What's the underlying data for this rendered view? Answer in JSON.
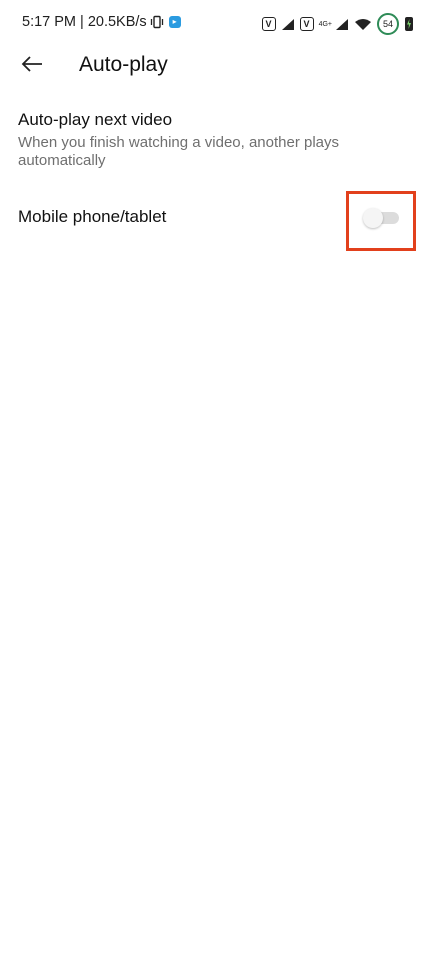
{
  "status_bar": {
    "time_speed": "5:17 PM | 20.5KB/s",
    "network_label": "4G+",
    "volte_1": "V",
    "volte_2": "V",
    "battery": "54"
  },
  "header": {
    "title": "Auto-play"
  },
  "autoplay_section": {
    "title": "Auto-play next video",
    "description": "When you finish watching a video, another plays automatically"
  },
  "settings": [
    {
      "label": "Mobile phone/tablet",
      "enabled": false
    }
  ],
  "colors": {
    "highlight": "#e2401c",
    "toggle_track": "#dcdcdc",
    "battery_ring": "#2e8b57"
  }
}
